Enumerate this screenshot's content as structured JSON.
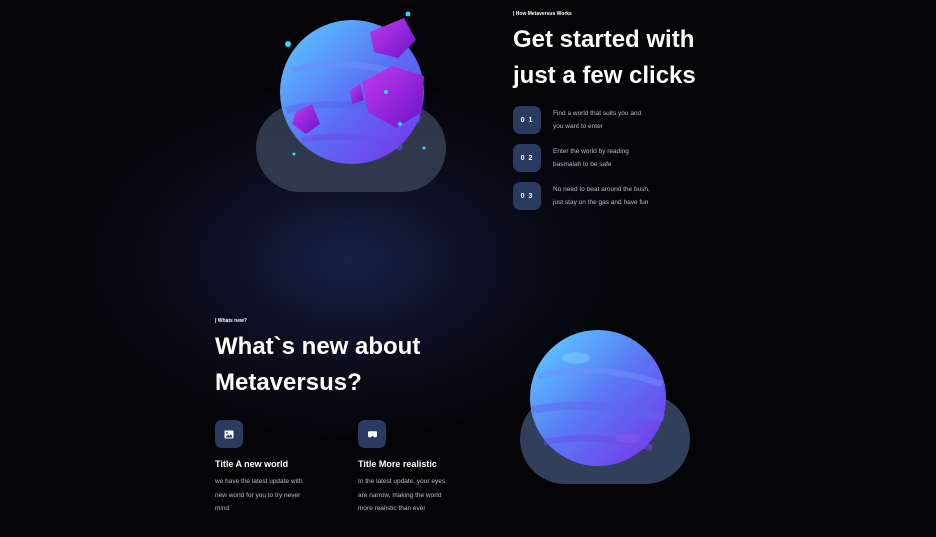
{
  "how": {
    "eyebrow": "| How Metaversus Works",
    "title_line1": "Get started with",
    "title_line2": "just a few clicks",
    "steps": [
      {
        "number": "0 1",
        "line1": "Find a world that suits you and",
        "line2": "you want to enter"
      },
      {
        "number": "0 2",
        "line1": "Enter the world by reading",
        "line2": "basmalah to be safe"
      },
      {
        "number": "0 3",
        "line1": "No need to beat around the bush,",
        "line2": "just stay on the gas and have fun"
      }
    ]
  },
  "new": {
    "eyebrow": "| Whats new?",
    "title_line1": "What`s new about",
    "title_line2": "Metaversus?",
    "features": [
      {
        "icon": "image-icon",
        "title": "Title A new world",
        "line1": "we have the latest update with",
        "line2": "new world for you to try never",
        "line3": "mind"
      },
      {
        "icon": "vr-headset-icon",
        "title": "Title More realistic",
        "line1": "In the latest update, your eyes",
        "line2": "are narrow, making the world",
        "line3": "more realistic than ever"
      }
    ]
  },
  "colors": {
    "background": "#040407",
    "badge": "#2b3a60",
    "planet_blue": "#4fb0ff",
    "planet_purple": "#7b2ff0",
    "crystal": "#9b1fe0"
  }
}
